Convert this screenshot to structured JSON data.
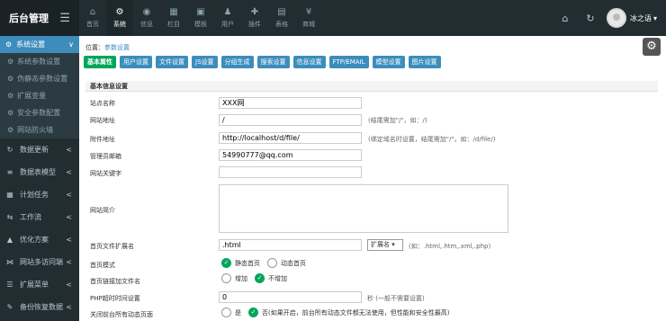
{
  "app": {
    "title": "后台管理"
  },
  "topnav": [
    {
      "label": "首页",
      "icon": "home-icon",
      "glyph": "⌂"
    },
    {
      "label": "系统",
      "icon": "cogs-icon",
      "glyph": "⚙"
    },
    {
      "label": "信息",
      "icon": "globe-icon",
      "glyph": "◉"
    },
    {
      "label": "栏目",
      "icon": "grid-icon",
      "glyph": "▦"
    },
    {
      "label": "模板",
      "icon": "html5-icon",
      "glyph": "▣"
    },
    {
      "label": "用户",
      "icon": "user-icon",
      "glyph": "♟"
    },
    {
      "label": "插件",
      "icon": "puzzle-icon",
      "glyph": "✚"
    },
    {
      "label": "表格",
      "icon": "table-icon",
      "glyph": "▤"
    },
    {
      "label": "商城",
      "icon": "yen-icon",
      "glyph": "¥"
    }
  ],
  "topright": {
    "home_glyph": "⌂",
    "refresh_glyph": "↻",
    "username": "冰之语",
    "caret": "▾"
  },
  "sidebar": {
    "head": {
      "label": "系统设置",
      "arrow": "∨"
    },
    "subitems": [
      {
        "label": "系统参数设置"
      },
      {
        "label": "伪静态参数设置"
      },
      {
        "label": "扩展变量"
      },
      {
        "label": "安全参数配置"
      },
      {
        "label": "网站防火墙"
      }
    ],
    "menu": [
      {
        "label": "数据更新",
        "icon": "refresh-icon",
        "glyph": "↻"
      },
      {
        "label": "数据表模型",
        "icon": "database-icon",
        "glyph": "≡"
      },
      {
        "label": "计划任务",
        "icon": "calendar-icon",
        "glyph": "▦"
      },
      {
        "label": "工作流",
        "icon": "flow-icon",
        "glyph": "⇆"
      },
      {
        "label": "优化方案",
        "icon": "chart-icon",
        "glyph": "▲"
      },
      {
        "label": "网站多访问端",
        "icon": "share-icon",
        "glyph": "⋈"
      },
      {
        "label": "扩展菜单",
        "icon": "list-icon",
        "glyph": "☰"
      },
      {
        "label": "备份恢复数据",
        "icon": "wrench-icon",
        "glyph": "✎"
      }
    ],
    "arrow": "<"
  },
  "breadcrumb": {
    "prefix": "位置：",
    "current": "参数设置"
  },
  "tabs": [
    {
      "label": "基本属性"
    },
    {
      "label": "用户设置"
    },
    {
      "label": "文件设置"
    },
    {
      "label": "JS设置"
    },
    {
      "label": "分组生成"
    },
    {
      "label": "搜索设置"
    },
    {
      "label": "信息设置"
    },
    {
      "label": "FTP/EMAIL"
    },
    {
      "label": "模型设置"
    },
    {
      "label": "图片设置"
    }
  ],
  "section": {
    "title": "基本信息设置"
  },
  "form": {
    "site_name": {
      "label": "站点名称",
      "value": "XXX网"
    },
    "site_url": {
      "label": "网站地址",
      "value": "/",
      "hint": "(结尾需加\"/\"，如：/)"
    },
    "attach_url": {
      "label": "附件地址",
      "value": "http://localhost/d/file/",
      "hint": "(绑定域名时设置，结尾需加\"/\"，如：/d/file/)"
    },
    "admin_email": {
      "label": "管理员邮箱",
      "value": "54990777@qq.com"
    },
    "keywords": {
      "label": "网站关键字",
      "value": ""
    },
    "description": {
      "label": "网站简介"
    },
    "index_ext": {
      "label": "首页文件扩展名",
      "value": ".html",
      "select": "扩展名",
      "select_caret": "▾",
      "hint": "(如：.html,.htm,.xml,.php)"
    },
    "index_mode": {
      "label": "首页模式",
      "opt1": "静态首页",
      "opt2": "动态首页"
    },
    "index_link": {
      "label": "首页链接加文件名",
      "opt1": "增加",
      "opt2": "不增加"
    },
    "php_timeout": {
      "label": "PHP超时时间设置",
      "value": "0",
      "hint": "秒 (一般不需要设置)"
    },
    "close_dynamic": {
      "label": "关闭前台所有动态页面",
      "opt1": "是",
      "opt2": "否(如果开启，前台所有动态文件都无法使用，但性能和安全性最高)"
    }
  },
  "colors": {
    "accent": "#3c8dbc",
    "success": "#00a65a",
    "sidebar": "#222d32"
  }
}
